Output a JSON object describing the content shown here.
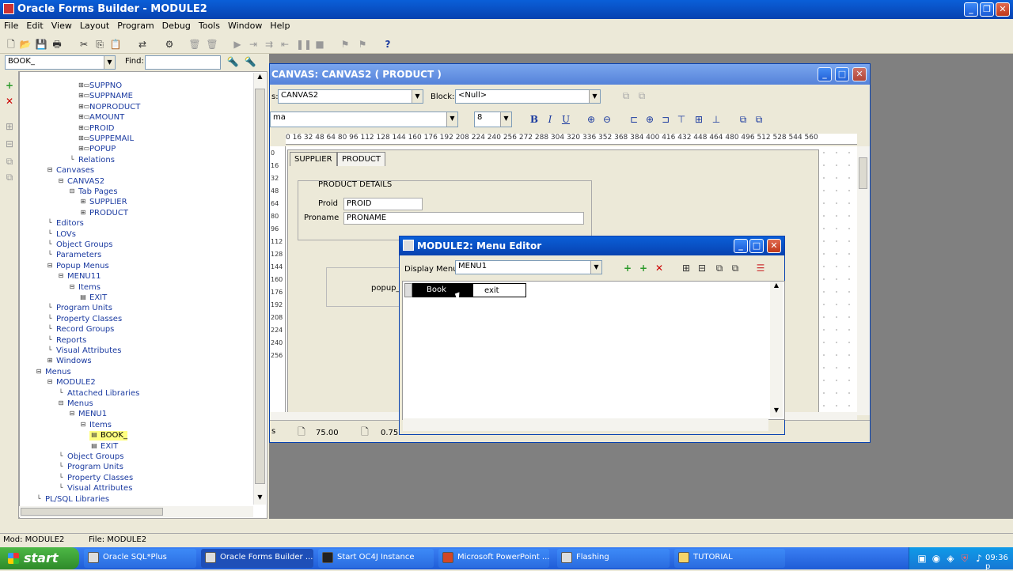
{
  "window": {
    "title": "Oracle Forms Builder - MODULE2"
  },
  "menubar": [
    "File",
    "Edit",
    "View",
    "Layout",
    "Program",
    "Debug",
    "Tools",
    "Window",
    "Help"
  ],
  "navigator": {
    "combo_value": "BOOK_",
    "find_label": "Find:",
    "tree": [
      {
        "label": "SUPPNO",
        "level": 5,
        "icon": "item"
      },
      {
        "label": "SUPPNAME",
        "level": 5,
        "icon": "item"
      },
      {
        "label": "NOPRODUCT",
        "level": 5,
        "icon": "item"
      },
      {
        "label": "AMOUNT",
        "level": 5,
        "icon": "item"
      },
      {
        "label": "PROID",
        "level": 5,
        "icon": "item"
      },
      {
        "label": "SUPPEMAIL",
        "level": 5,
        "icon": "item"
      },
      {
        "label": "POPUP",
        "level": 5,
        "icon": "item"
      },
      {
        "label": "Relations",
        "level": 4,
        "icon": ""
      },
      {
        "label": "Canvases",
        "level": 2,
        "icon": "minus"
      },
      {
        "label": "CANVAS2",
        "level": 3,
        "icon": "minus"
      },
      {
        "label": "Tab Pages",
        "level": 4,
        "icon": "minus"
      },
      {
        "label": "SUPPLIER",
        "level": 5,
        "icon": "plus"
      },
      {
        "label": "PRODUCT",
        "level": 5,
        "icon": "plus"
      },
      {
        "label": "Editors",
        "level": 2,
        "icon": ""
      },
      {
        "label": "LOVs",
        "level": 2,
        "icon": ""
      },
      {
        "label": "Object Groups",
        "level": 2,
        "icon": ""
      },
      {
        "label": "Parameters",
        "level": 2,
        "icon": ""
      },
      {
        "label": "Popup Menus",
        "level": 2,
        "icon": "minus"
      },
      {
        "label": "MENU11",
        "level": 3,
        "icon": "minus"
      },
      {
        "label": "Items",
        "level": 4,
        "icon": "minus"
      },
      {
        "label": "EXIT",
        "level": 5,
        "icon": "leaf"
      },
      {
        "label": "Program Units",
        "level": 2,
        "icon": ""
      },
      {
        "label": "Property Classes",
        "level": 2,
        "icon": ""
      },
      {
        "label": "Record Groups",
        "level": 2,
        "icon": ""
      },
      {
        "label": "Reports",
        "level": 2,
        "icon": ""
      },
      {
        "label": "Visual Attributes",
        "level": 2,
        "icon": ""
      },
      {
        "label": "Windows",
        "level": 2,
        "icon": "plus"
      },
      {
        "label": "Menus",
        "level": 1,
        "icon": "minus"
      },
      {
        "label": "MODULE2",
        "level": 2,
        "icon": "minus"
      },
      {
        "label": "Attached Libraries",
        "level": 3,
        "icon": ""
      },
      {
        "label": "Menus",
        "level": 3,
        "icon": "minus"
      },
      {
        "label": "MENU1",
        "level": 4,
        "icon": "minus"
      },
      {
        "label": "Items",
        "level": 5,
        "icon": "minus"
      },
      {
        "label": "BOOK_",
        "level": 6,
        "icon": "leaf",
        "selected": true
      },
      {
        "label": "EXIT",
        "level": 6,
        "icon": "leaf"
      },
      {
        "label": "Object Groups",
        "level": 3,
        "icon": ""
      },
      {
        "label": "Program Units",
        "level": 3,
        "icon": ""
      },
      {
        "label": "Property Classes",
        "level": 3,
        "icon": ""
      },
      {
        "label": "Visual Attributes",
        "level": 3,
        "icon": ""
      },
      {
        "label": "PL/SQL Libraries",
        "level": 1,
        "icon": ""
      }
    ]
  },
  "canvas_window": {
    "title": "CANVAS: CANVAS2 ( PRODUCT )",
    "canvas_label": "s:",
    "canvas_value": "CANVAS2",
    "block_label": "Block:",
    "block_value": "<Null>",
    "font_value": "ma",
    "size_value": "8",
    "bold": "B",
    "italic": "I",
    "underline": "U",
    "ruler": "0 16 32 48 64 80 96 112 128 144 160 176 192 208 224 240 256 272 288 304 320 336 352 368 384 400 416 432 448 464 480 496 512 528 544 560",
    "ruler_v": [
      "0",
      "16",
      "32",
      "48",
      "64",
      "80",
      "96",
      "112",
      "128",
      "144",
      "160",
      "176",
      "192",
      "208",
      "224",
      "240",
      "256"
    ],
    "tabs": [
      "SUPPLIER",
      "PRODUCT"
    ],
    "frame_title": "PRODUCT DETAILS",
    "proid_label": "Proid",
    "proid_value": "PROID",
    "proname_label": "Proname",
    "proname_value": "PRONAME",
    "popup_text": "popup_",
    "status_left": "s",
    "status_x": "75.00",
    "status_y": "0.75"
  },
  "menu_editor": {
    "title": "MODULE2: Menu Editor",
    "display_label": "Display Menu:",
    "display_value": "MENU1",
    "items": [
      "Book",
      "exit"
    ]
  },
  "statusbar": {
    "mod": "Mod: MODULE2",
    "file": "File: MODULE2"
  },
  "taskbar": {
    "start": "start",
    "tasks": [
      "Oracle SQL*Plus",
      "Oracle Forms Builder ...",
      "Start OC4J Instance",
      "Microsoft PowerPoint ...",
      "Flashing",
      "TUTORIAL"
    ],
    "clock": "09:36 p"
  }
}
